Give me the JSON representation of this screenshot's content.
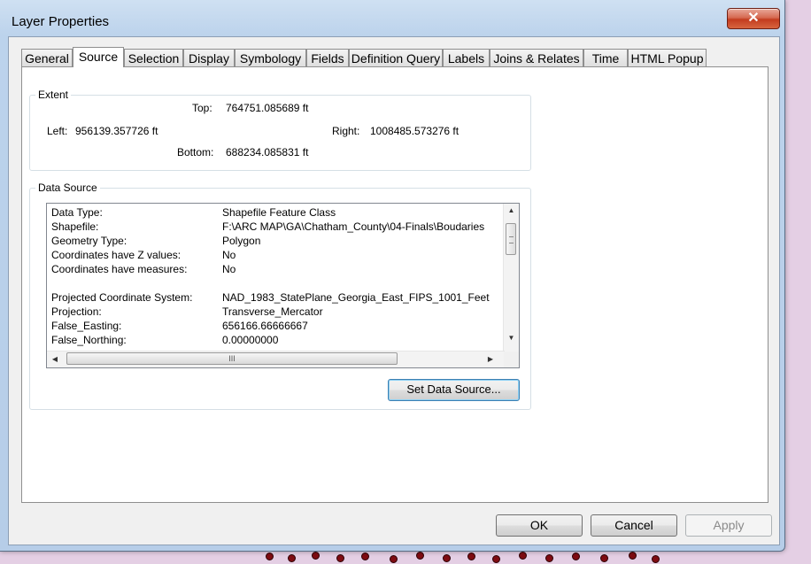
{
  "window": {
    "title": "Layer Properties",
    "close_glyph": "✕"
  },
  "tabs": [
    {
      "label": "General"
    },
    {
      "label": "Source",
      "active": true
    },
    {
      "label": "Selection"
    },
    {
      "label": "Display"
    },
    {
      "label": "Symbology"
    },
    {
      "label": "Fields"
    },
    {
      "label": "Definition Query"
    },
    {
      "label": "Labels"
    },
    {
      "label": "Joins & Relates"
    },
    {
      "label": "Time"
    },
    {
      "label": "HTML Popup"
    }
  ],
  "extent": {
    "group_label": "Extent",
    "top_label": "Top:",
    "top_value": "764751.085689 ft",
    "left_label": "Left:",
    "left_value": "956139.357726 ft",
    "right_label": "Right:",
    "right_value": "1008485.573276 ft",
    "bottom_label": "Bottom:",
    "bottom_value": "688234.085831 ft"
  },
  "data_source": {
    "group_label": "Data Source",
    "rows": [
      {
        "key": "Data Type:",
        "value": "Shapefile Feature Class"
      },
      {
        "key": "Shapefile:",
        "value": "F:\\ARC MAP\\GA\\Chatham_County\\04-Finals\\Boudaries"
      },
      {
        "key": "Geometry Type:",
        "value": "Polygon"
      },
      {
        "key": "Coordinates have Z values:",
        "value": "No"
      },
      {
        "key": "Coordinates have measures:",
        "value": "No"
      },
      {
        "key": "",
        "value": ""
      },
      {
        "key": "Projected Coordinate System:",
        "value": "NAD_1983_StatePlane_Georgia_East_FIPS_1001_Feet"
      },
      {
        "key": "Projection:",
        "value": "Transverse_Mercator"
      },
      {
        "key": "False_Easting:",
        "value": "656166.66666667"
      },
      {
        "key": "False_Northing:",
        "value": "0.00000000"
      }
    ],
    "hthumb_grip": "III",
    "set_button": "Set Data Source..."
  },
  "footer": {
    "ok": "OK",
    "cancel": "Cancel",
    "apply": "Apply"
  },
  "colors": {
    "title_bar": "#bcd3ec",
    "close_button": "#c33b1f",
    "focus_border": "#3c7fb1"
  }
}
